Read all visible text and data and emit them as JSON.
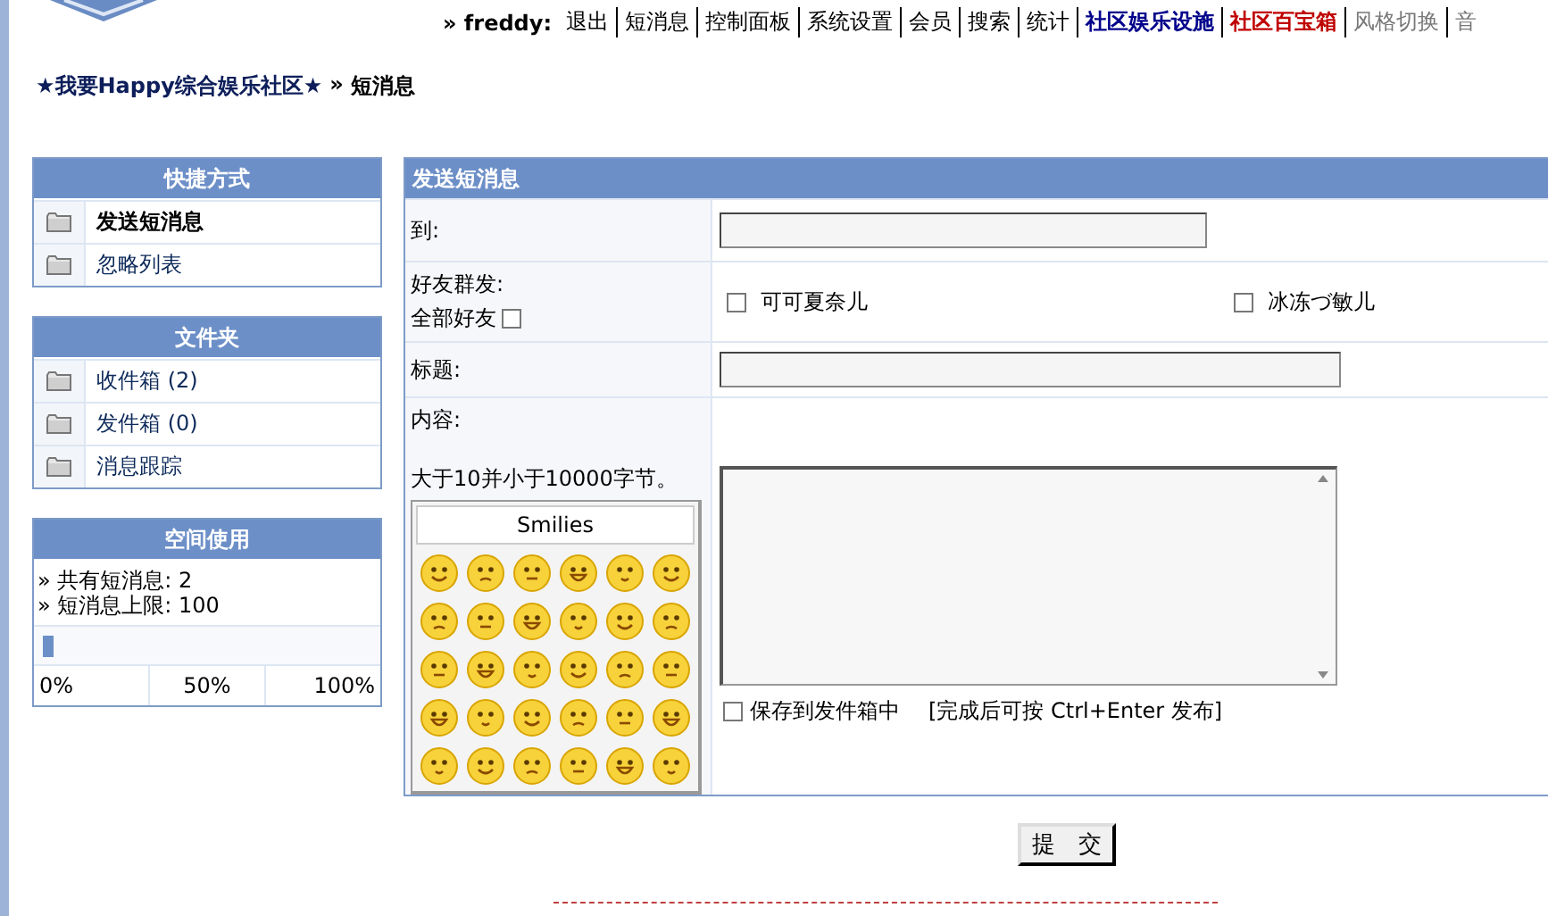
{
  "top_nav": {
    "user": "» freddy:",
    "links": [
      {
        "label": "退出",
        "kind": "normal"
      },
      {
        "label": "短消息",
        "kind": "normal"
      },
      {
        "label": "控制面板",
        "kind": "normal"
      },
      {
        "label": "系统设置",
        "kind": "normal"
      },
      {
        "label": "会员",
        "kind": "normal"
      },
      {
        "label": "搜索",
        "kind": "normal"
      },
      {
        "label": "统计",
        "kind": "normal"
      },
      {
        "label": "社区娱乐设施",
        "kind": "blue"
      },
      {
        "label": "社区百宝箱",
        "kind": "red"
      },
      {
        "label": "风格切换",
        "kind": "muted"
      },
      {
        "label": "音",
        "kind": "muted"
      }
    ]
  },
  "breadcrumb": {
    "home": "★我要Happy综合娱乐社区★",
    "separator": "»",
    "current": "短消息"
  },
  "shortcuts": {
    "title": "快捷方式",
    "items": [
      {
        "label": "发送短消息",
        "selected": true
      },
      {
        "label": "忽略列表",
        "selected": false
      }
    ]
  },
  "folders": {
    "title": "文件夹",
    "items": [
      {
        "label": "收件箱 (2)",
        "selected": false
      },
      {
        "label": "发件箱 (0)",
        "selected": false
      },
      {
        "label": "消息跟踪",
        "selected": false
      }
    ]
  },
  "space": {
    "title": "空间使用",
    "lines": [
      "» 共有短消息: 2",
      "» 短消息上限: 100"
    ],
    "level": 0.02,
    "scale": [
      "0%",
      "50%",
      "100%"
    ]
  },
  "form": {
    "title": "发送短消息",
    "to": {
      "label": "到:"
    },
    "friends": {
      "label": "好友群发:",
      "all_label": "全部好友",
      "all_checked": false,
      "list": [
        {
          "name": "可可夏奈儿",
          "checked": false
        },
        {
          "name": "冰冻づ敏儿",
          "checked": false
        }
      ]
    },
    "subject": {
      "label": "标题:"
    },
    "content": {
      "label": "内容:",
      "hint": "大于10并小于10000字节。",
      "smilies_title": "Smilies"
    },
    "save": {
      "label": "保存到发件箱中",
      "checked": false
    },
    "shortcut_hint": "[完成后可按 Ctrl+Enter 发布]"
  },
  "submit": "提　交"
}
